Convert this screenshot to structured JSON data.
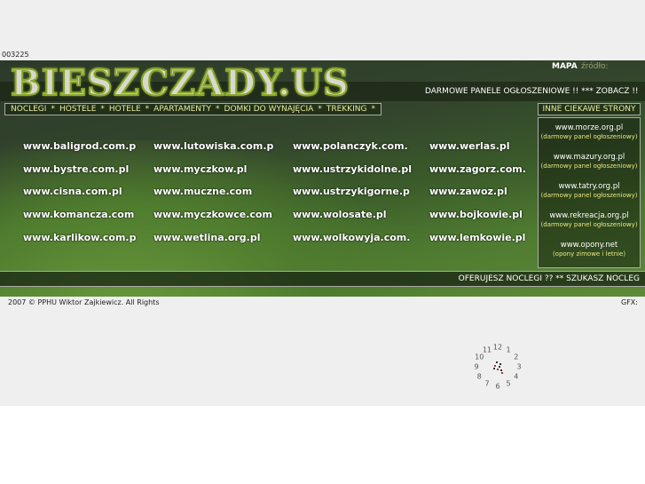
{
  "counter": "003225",
  "header": {
    "logo": "BIESZCZADY.US",
    "mapa": "MAPA",
    "zrodlo": "źródło:",
    "promo": "DARMOWE PANELE OGŁOSZENIOWE !!  ***  ZOBACZ !!"
  },
  "nav": [
    "NOCLEGI",
    "HOSTELE",
    "HOTELE",
    "APARTAMENTY",
    "DOMKI DO WYNAJĘCIA",
    "TREKKING"
  ],
  "nav_sep": "*",
  "sidebar": {
    "title": "INNE CIEKAWE STRONY",
    "items": [
      {
        "url": "www.morze.org.pl",
        "desc": "(darmowy panel ogłoszeniowy)"
      },
      {
        "url": "www.mazury.org.pl",
        "desc": "(darmowy panel ogłoszeniowy)"
      },
      {
        "url": "www.tatry.org.pl",
        "desc": "(darmowy panel ogłoszeniowy)"
      },
      {
        "url": "www.rekreacja.org.pl",
        "desc": "(darmowy panel ogłoszeniowy)"
      },
      {
        "url": "www.opony.net",
        "desc": "(opony zimowe i letnie)"
      }
    ]
  },
  "sites": [
    [
      "www.baligrod.com.p",
      "www.lutowiska.com.p",
      "www.polanczyk.com.",
      "www.werlas.pl"
    ],
    [
      "www.bystre.com.pl",
      "www.myczkow.pl",
      "www.ustrzykidolne.pl",
      "www.zagorz.com."
    ],
    [
      "www.cisna.com.pl",
      "www.muczne.com",
      "www.ustrzykigorne.p",
      "www.zawoz.pl"
    ],
    [
      "www.komancza.com",
      "www.myczkowce.com",
      "www.wolosate.pl",
      "www.bojkowie.pl"
    ],
    [
      "www.karlikow.com.p",
      "www.wetlina.org.pl",
      "www.wolkowyja.com.",
      "www.lemkowie.pl"
    ]
  ],
  "bottom": "OFERUJESZ NOCLEGI ??  **  SZUKASZ NOCLEG",
  "footer": {
    "copyright": "2007 © PPHU Wiktor Zajkiewicz. All Rights",
    "gfx": "GFX:"
  },
  "clock": {
    "numbers": [
      "12",
      "1",
      "2",
      "3",
      "4",
      "5",
      "6",
      "7",
      "8",
      "9",
      "10",
      "11"
    ]
  }
}
